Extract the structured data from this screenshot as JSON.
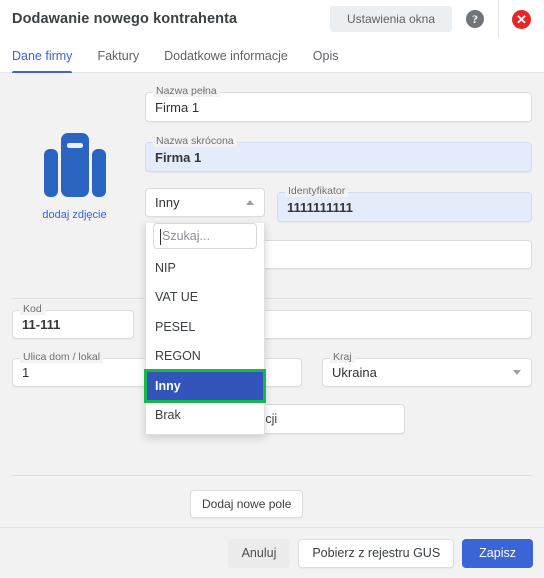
{
  "header": {
    "title": "Dodawanie nowego kontrahenta",
    "settings_label": "Ustawienia okna",
    "help_glyph": "?",
    "close_glyph": "✕"
  },
  "tabs": [
    {
      "label": "Dane firmy",
      "active": true
    },
    {
      "label": "Faktury",
      "active": false
    },
    {
      "label": "Dodatkowe informacje",
      "active": false
    },
    {
      "label": "Opis",
      "active": false
    }
  ],
  "avatar": {
    "caption": "dodaj zdjęcie",
    "icon": "briefcase-icon",
    "color": "#2b64c0"
  },
  "fields": {
    "full_name": {
      "label": "Nazwa pełna",
      "value": "Firma 1",
      "placeholder": ""
    },
    "short_name": {
      "label": "Nazwa skrócona",
      "value": "Firma 1",
      "placeholder": ""
    },
    "identifier": {
      "label": "Identyfikator",
      "value": "1111111111",
      "placeholder": ""
    },
    "blank_1": {
      "label": "",
      "value": "",
      "placeholder": ""
    },
    "blank_2": {
      "label": "",
      "value": "",
      "placeholder": ""
    },
    "kod": {
      "label": "Kod",
      "value": "11-111",
      "placeholder": ""
    },
    "street": {
      "label": "Ulica dom / lokal",
      "value": "1",
      "placeholder": ""
    },
    "country": {
      "label": "Kraj",
      "value": "Ukraina",
      "placeholder": ""
    }
  },
  "dropdown": {
    "name": "identifier-type-select",
    "selected": "Inny",
    "open": true,
    "search_placeholder": "Szukaj...",
    "search_value": "",
    "options": [
      "NIP",
      "VAT UE",
      "PESEL",
      "REGON",
      "Inny",
      "Brak"
    ],
    "highlight_color": "#3355bb",
    "focus_outline_color": "#17b84a"
  },
  "buttons": {
    "correspondence": "Adres korespondencji",
    "add_field": "Dodaj nowe pole",
    "cancel": "Anuluj",
    "gus": "Pobierz z rejestru GUS",
    "save": "Zapisz"
  },
  "colors": {
    "accent": "#3b64d6",
    "filled_field": "#e4ecfb",
    "page_bg": "#f2f2f2",
    "close_red": "#e8252a"
  }
}
